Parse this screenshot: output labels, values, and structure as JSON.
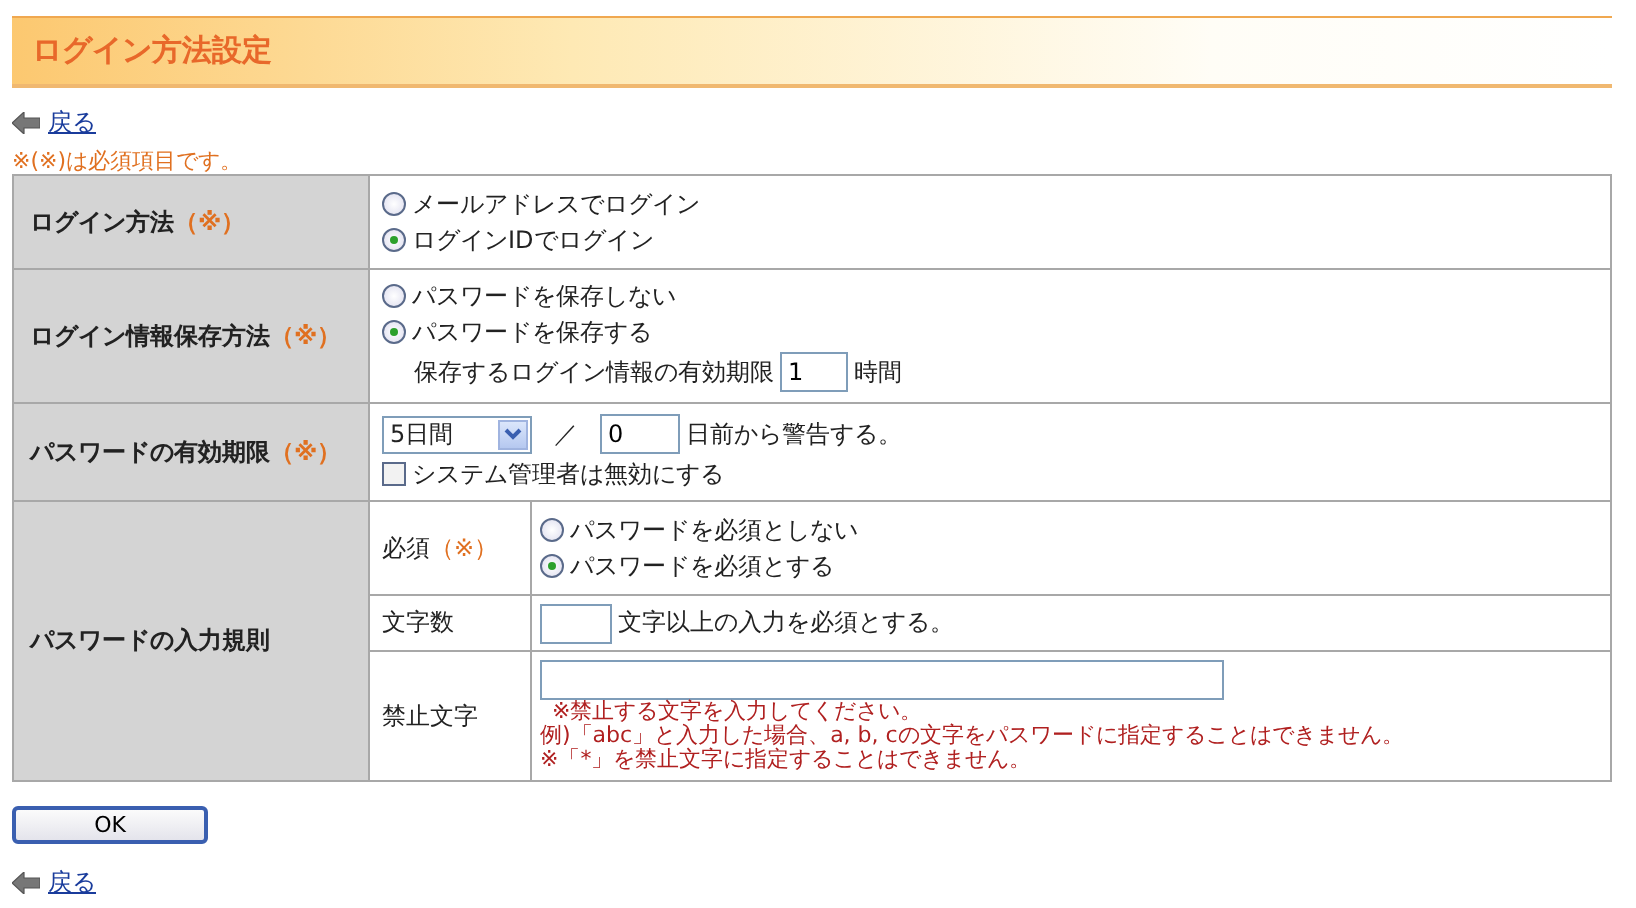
{
  "header": {
    "title": "ログイン方法設定"
  },
  "back_link_top": {
    "label": "戻る"
  },
  "required_note": "※(※)は必須項目です。",
  "form": {
    "rows": [
      {
        "kind": "radio",
        "label": "ログイン方法",
        "required_mark": "（※）",
        "options": [
          {
            "label": "メールアドレスでログイン",
            "selected": false
          },
          {
            "label": "ログインIDでログイン",
            "selected": true
          }
        ]
      },
      {
        "kind": "radio",
        "label": "ログイン情報保存方法",
        "required_mark": "（※）",
        "options": [
          {
            "label": "パスワードを保存しない",
            "selected": false
          },
          {
            "label": "パスワードを保存する",
            "selected": true
          }
        ],
        "sub_field": {
          "prefix": "保存するログイン情報の有効期限",
          "value": "1",
          "suffix": "時間"
        }
      },
      {
        "kind": "expiry",
        "label": "パスワードの有効期限",
        "required_mark": "（※）",
        "select_value": "5日間",
        "separator": "／",
        "days_value": "0",
        "days_suffix": "日前から警告する。",
        "checkbox": {
          "label": "システム管理者は無効にする",
          "checked": false
        }
      },
      {
        "kind": "group",
        "label": "パスワードの入力規則",
        "subrows": [
          {
            "kind": "radio",
            "label": "必須",
            "required_mark": "（※）",
            "options": [
              {
                "label": "パスワードを必須としない",
                "selected": false
              },
              {
                "label": "パスワードを必須とする",
                "selected": true
              }
            ]
          },
          {
            "kind": "length",
            "label": "文字数",
            "suffix": "文字以上の入力を必須とする。"
          },
          {
            "kind": "forbidden",
            "label": "禁止文字",
            "notes": [
              "※禁止する文字を入力してください。",
              "例)「abc」と入力した場合、a, b, cの文字をパスワードに指定することはできません。",
              "※「*」を禁止文字に指定することはできません。"
            ]
          }
        ]
      }
    ]
  },
  "ok_button": "OK",
  "back_link_bottom": {
    "label": "戻る"
  }
}
